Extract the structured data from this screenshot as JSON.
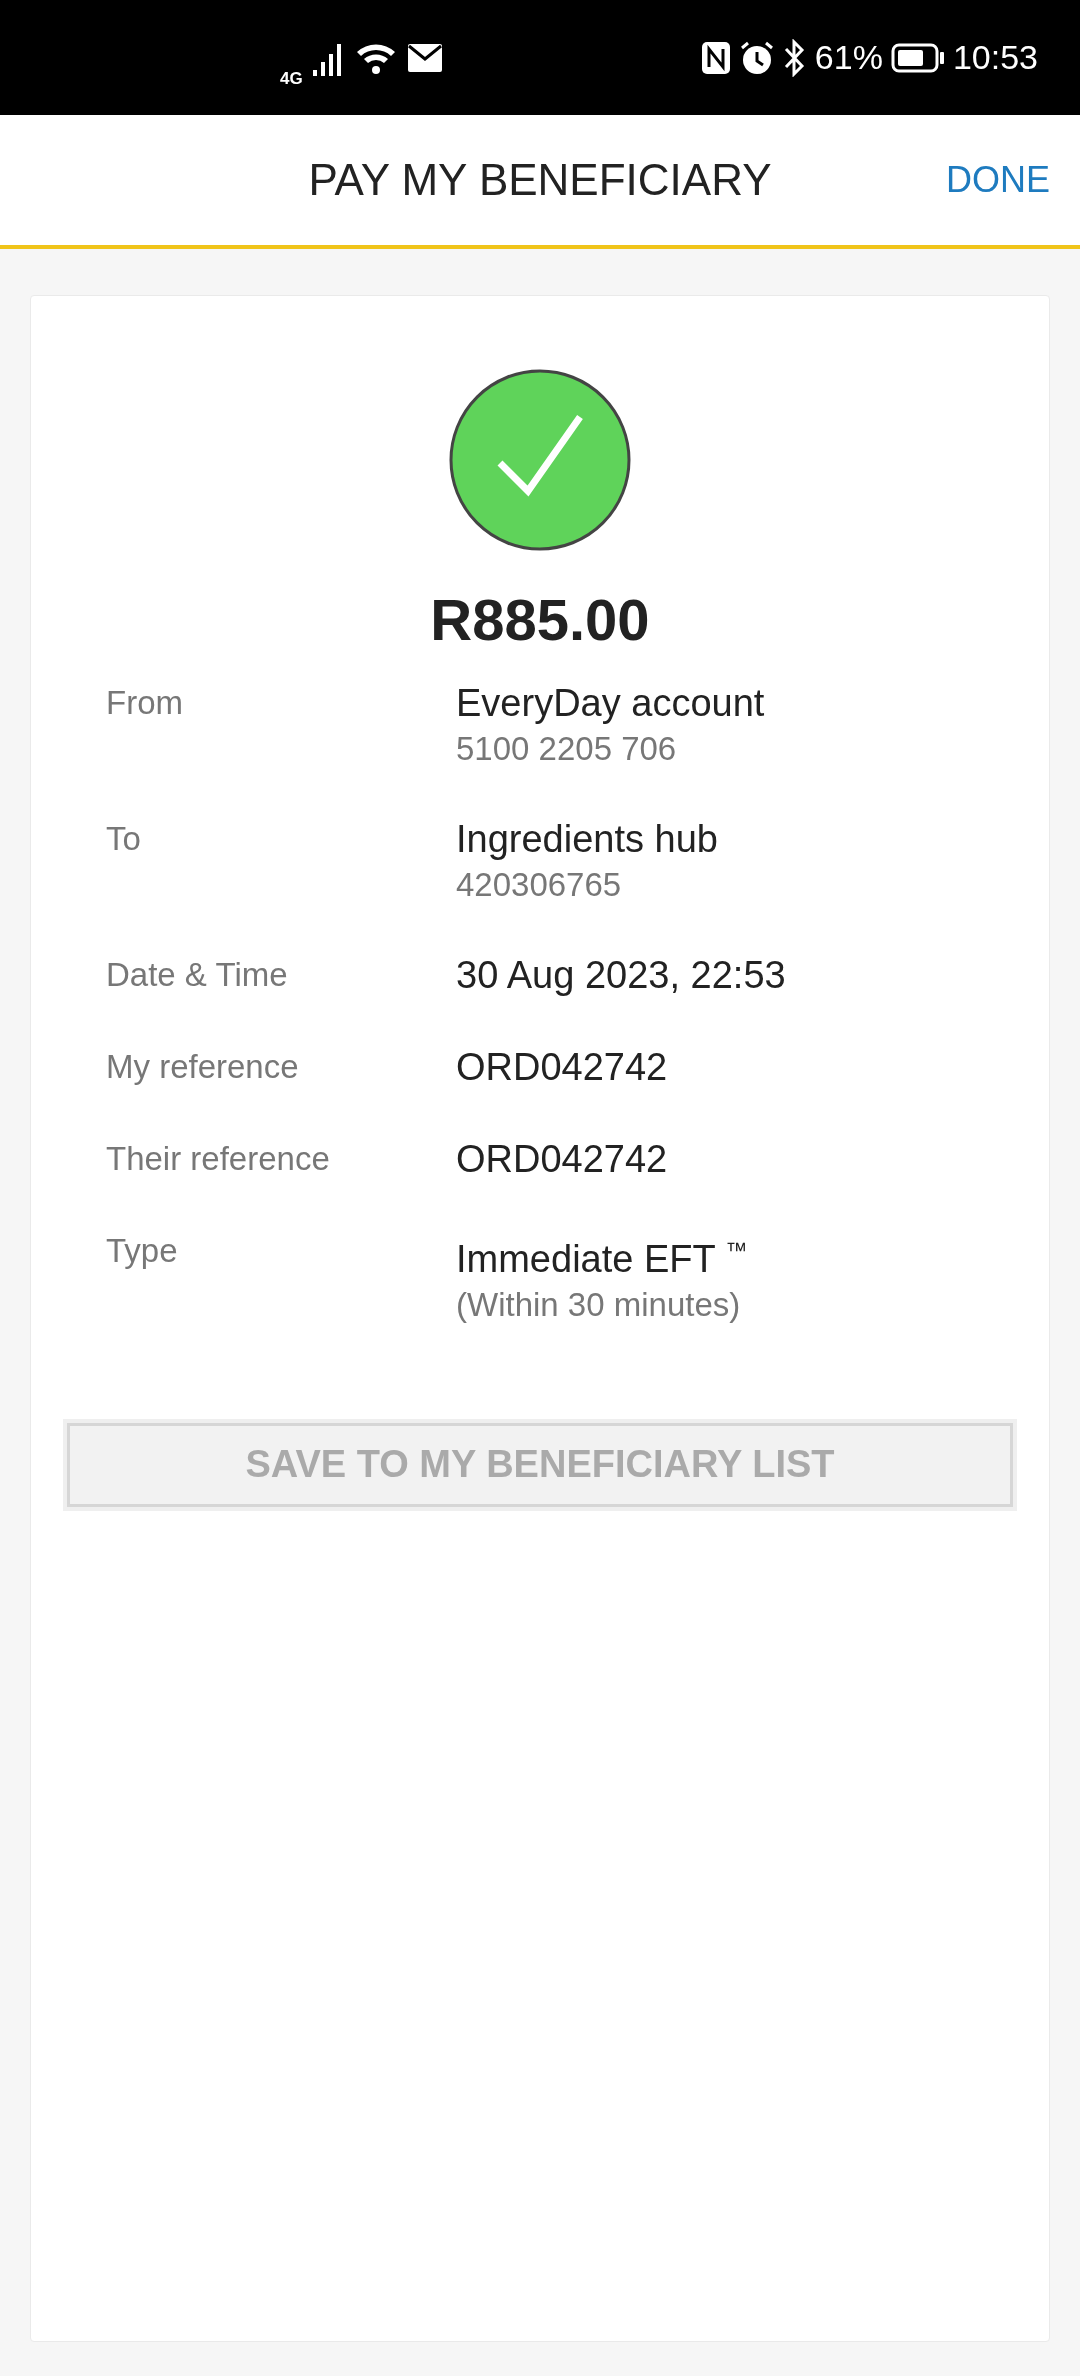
{
  "status_bar": {
    "network": "4G",
    "battery": "61%",
    "time": "10:53"
  },
  "header": {
    "title": "PAY MY BENEFICIARY",
    "action": "DONE"
  },
  "receipt": {
    "amount": "R885.00",
    "details": [
      {
        "label": "From",
        "value": "EveryDay account",
        "sub": "5100 2205 706"
      },
      {
        "label": "To",
        "value": "Ingredients hub",
        "sub": "420306765"
      },
      {
        "label": "Date & Time",
        "value": "30 Aug 2023, 22:53"
      },
      {
        "label": "My reference",
        "value": "ORD042742"
      },
      {
        "label": "Their reference",
        "value": "ORD042742"
      },
      {
        "label": "Type",
        "value": "Immediate EFT $^{™}$",
        "sub": "(Within 30 minutes)"
      }
    ],
    "save_button": {
      "label": "SAVE TO MY BENEFICIARY LIST",
      "disabled": true
    }
  }
}
